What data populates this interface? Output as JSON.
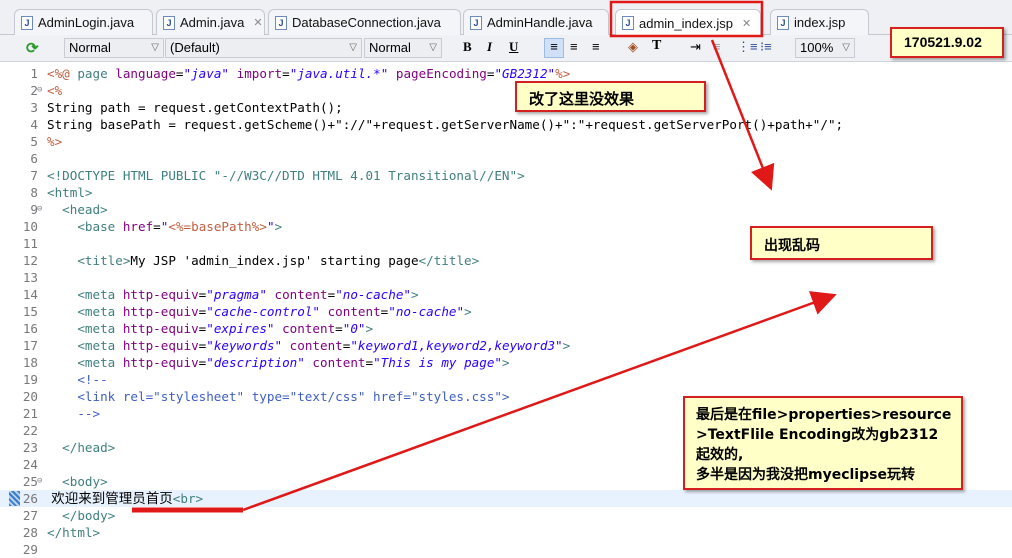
{
  "tabs": [
    {
      "label": "AdminLogin.java",
      "icon": "java-file-warning-icon"
    },
    {
      "label": "Admin.java",
      "icon": "java-file-icon",
      "closable": true
    },
    {
      "label": "DatabaseConnection.java",
      "icon": "java-file-warning-icon"
    },
    {
      "label": "AdminHandle.java",
      "icon": "java-file-icon"
    },
    {
      "label": "admin_index.jsp",
      "icon": "jsp-file-icon",
      "closable": true,
      "active": true
    },
    {
      "label": "index.jsp",
      "icon": "jsp-file-icon"
    }
  ],
  "toolbar": {
    "paragraph": "Normal",
    "font": "(Default)",
    "size": "Normal",
    "bold": "B",
    "italic": "I",
    "underline": "U",
    "zoom": "100%"
  },
  "code_lines": [
    [
      [
        "j",
        "<%@"
      ],
      [
        "t",
        " page "
      ],
      [
        "a",
        "language"
      ],
      [
        "p",
        "="
      ],
      [
        "v",
        "\"java\""
      ],
      [
        "p",
        " "
      ],
      [
        "a",
        "import"
      ],
      [
        "p",
        "="
      ],
      [
        "v",
        "\"java.util.*\""
      ],
      [
        "p",
        " "
      ],
      [
        "a",
        "pageEncoding"
      ],
      [
        "p",
        "="
      ],
      [
        "v",
        "\"GB2312\""
      ],
      [
        "j",
        "%>"
      ]
    ],
    [
      [
        "j",
        "<%"
      ]
    ],
    [
      [
        "p",
        "String path = request.getContextPath();"
      ]
    ],
    [
      [
        "p",
        "String basePath = request.getScheme()+\"://\"+request.getServerName()+\":\"+request.getServerPort()+path+\"/\";"
      ]
    ],
    [
      [
        "j",
        "%>"
      ]
    ],
    [],
    [
      [
        "t",
        "<!DOCTYPE HTML PUBLIC \"-//W3C//DTD HTML 4.01 Transitional//EN\">"
      ]
    ],
    [
      [
        "t",
        "<html>"
      ]
    ],
    [
      [
        "t",
        "  <head>"
      ]
    ],
    [
      [
        "t",
        "    <base "
      ],
      [
        "a",
        "href"
      ],
      [
        "p",
        "="
      ],
      [
        "v",
        "\""
      ],
      [
        "j",
        "<%=basePath%>"
      ],
      [
        "v",
        "\""
      ],
      [
        "t",
        ">"
      ]
    ],
    [],
    [
      [
        "t",
        "    <title>"
      ],
      [
        "p",
        "My JSP 'admin_index.jsp' starting page"
      ],
      [
        "t",
        "</title>"
      ]
    ],
    [],
    [
      [
        "t",
        "    <meta "
      ],
      [
        "a",
        "http-equiv"
      ],
      [
        "p",
        "="
      ],
      [
        "v",
        "\"pragma\""
      ],
      [
        "p",
        " "
      ],
      [
        "a",
        "content"
      ],
      [
        "p",
        "="
      ],
      [
        "v",
        "\"no-cache\""
      ],
      [
        "t",
        ">"
      ]
    ],
    [
      [
        "t",
        "    <meta "
      ],
      [
        "a",
        "http-equiv"
      ],
      [
        "p",
        "="
      ],
      [
        "v",
        "\"cache-control\""
      ],
      [
        "p",
        " "
      ],
      [
        "a",
        "content"
      ],
      [
        "p",
        "="
      ],
      [
        "v",
        "\"no-cache\""
      ],
      [
        "t",
        ">"
      ]
    ],
    [
      [
        "t",
        "    <meta "
      ],
      [
        "a",
        "http-equiv"
      ],
      [
        "p",
        "="
      ],
      [
        "v",
        "\"expires\""
      ],
      [
        "p",
        " "
      ],
      [
        "a",
        "content"
      ],
      [
        "p",
        "="
      ],
      [
        "v",
        "\"0\""
      ],
      [
        "t",
        ">"
      ]
    ],
    [
      [
        "t",
        "    <meta "
      ],
      [
        "a",
        "http-equiv"
      ],
      [
        "p",
        "="
      ],
      [
        "v",
        "\"keywords\""
      ],
      [
        "p",
        " "
      ],
      [
        "a",
        "content"
      ],
      [
        "p",
        "="
      ],
      [
        "v",
        "\"keyword1,keyword2,keyword3\""
      ],
      [
        "t",
        ">"
      ]
    ],
    [
      [
        "t",
        "    <meta "
      ],
      [
        "a",
        "http-equiv"
      ],
      [
        "p",
        "="
      ],
      [
        "v",
        "\"description\""
      ],
      [
        "p",
        " "
      ],
      [
        "a",
        "content"
      ],
      [
        "p",
        "="
      ],
      [
        "v",
        "\"This is my page\""
      ],
      [
        "t",
        ">"
      ]
    ],
    [
      [
        "c",
        "    <!--"
      ]
    ],
    [
      [
        "c",
        "    <link rel=\"stylesheet\" type=\"text/css\" href=\"styles.css\">"
      ]
    ],
    [
      [
        "c",
        "    -->"
      ]
    ],
    [],
    [
      [
        "t",
        "  </head>"
      ]
    ],
    [],
    [
      [
        "t",
        "  <body>"
      ]
    ],
    [
      [
        "cn",
        " 欢迎来到管理员首页"
      ],
      [
        "t",
        "<br>"
      ]
    ],
    [
      [
        "t",
        "  </body>"
      ]
    ],
    [
      [
        "t",
        "</html>"
      ]
    ],
    []
  ],
  "annotations": {
    "version": "170521.9.02",
    "note_encoding": "改了这里没效果",
    "note_garbled": "出现乱码",
    "note_solution": [
      "最后是在file>properties>resource",
      ">TextFlile Encoding改为gb2312",
      "起效的,",
      "多半是因为我没把myeclipse玩转"
    ]
  },
  "colors": {
    "annotation_border": "#d42020",
    "annotation_fill": "#ffffc8",
    "tag": "#3f7f7f",
    "attribute": "#7f007f",
    "value": "#2a00ff"
  }
}
